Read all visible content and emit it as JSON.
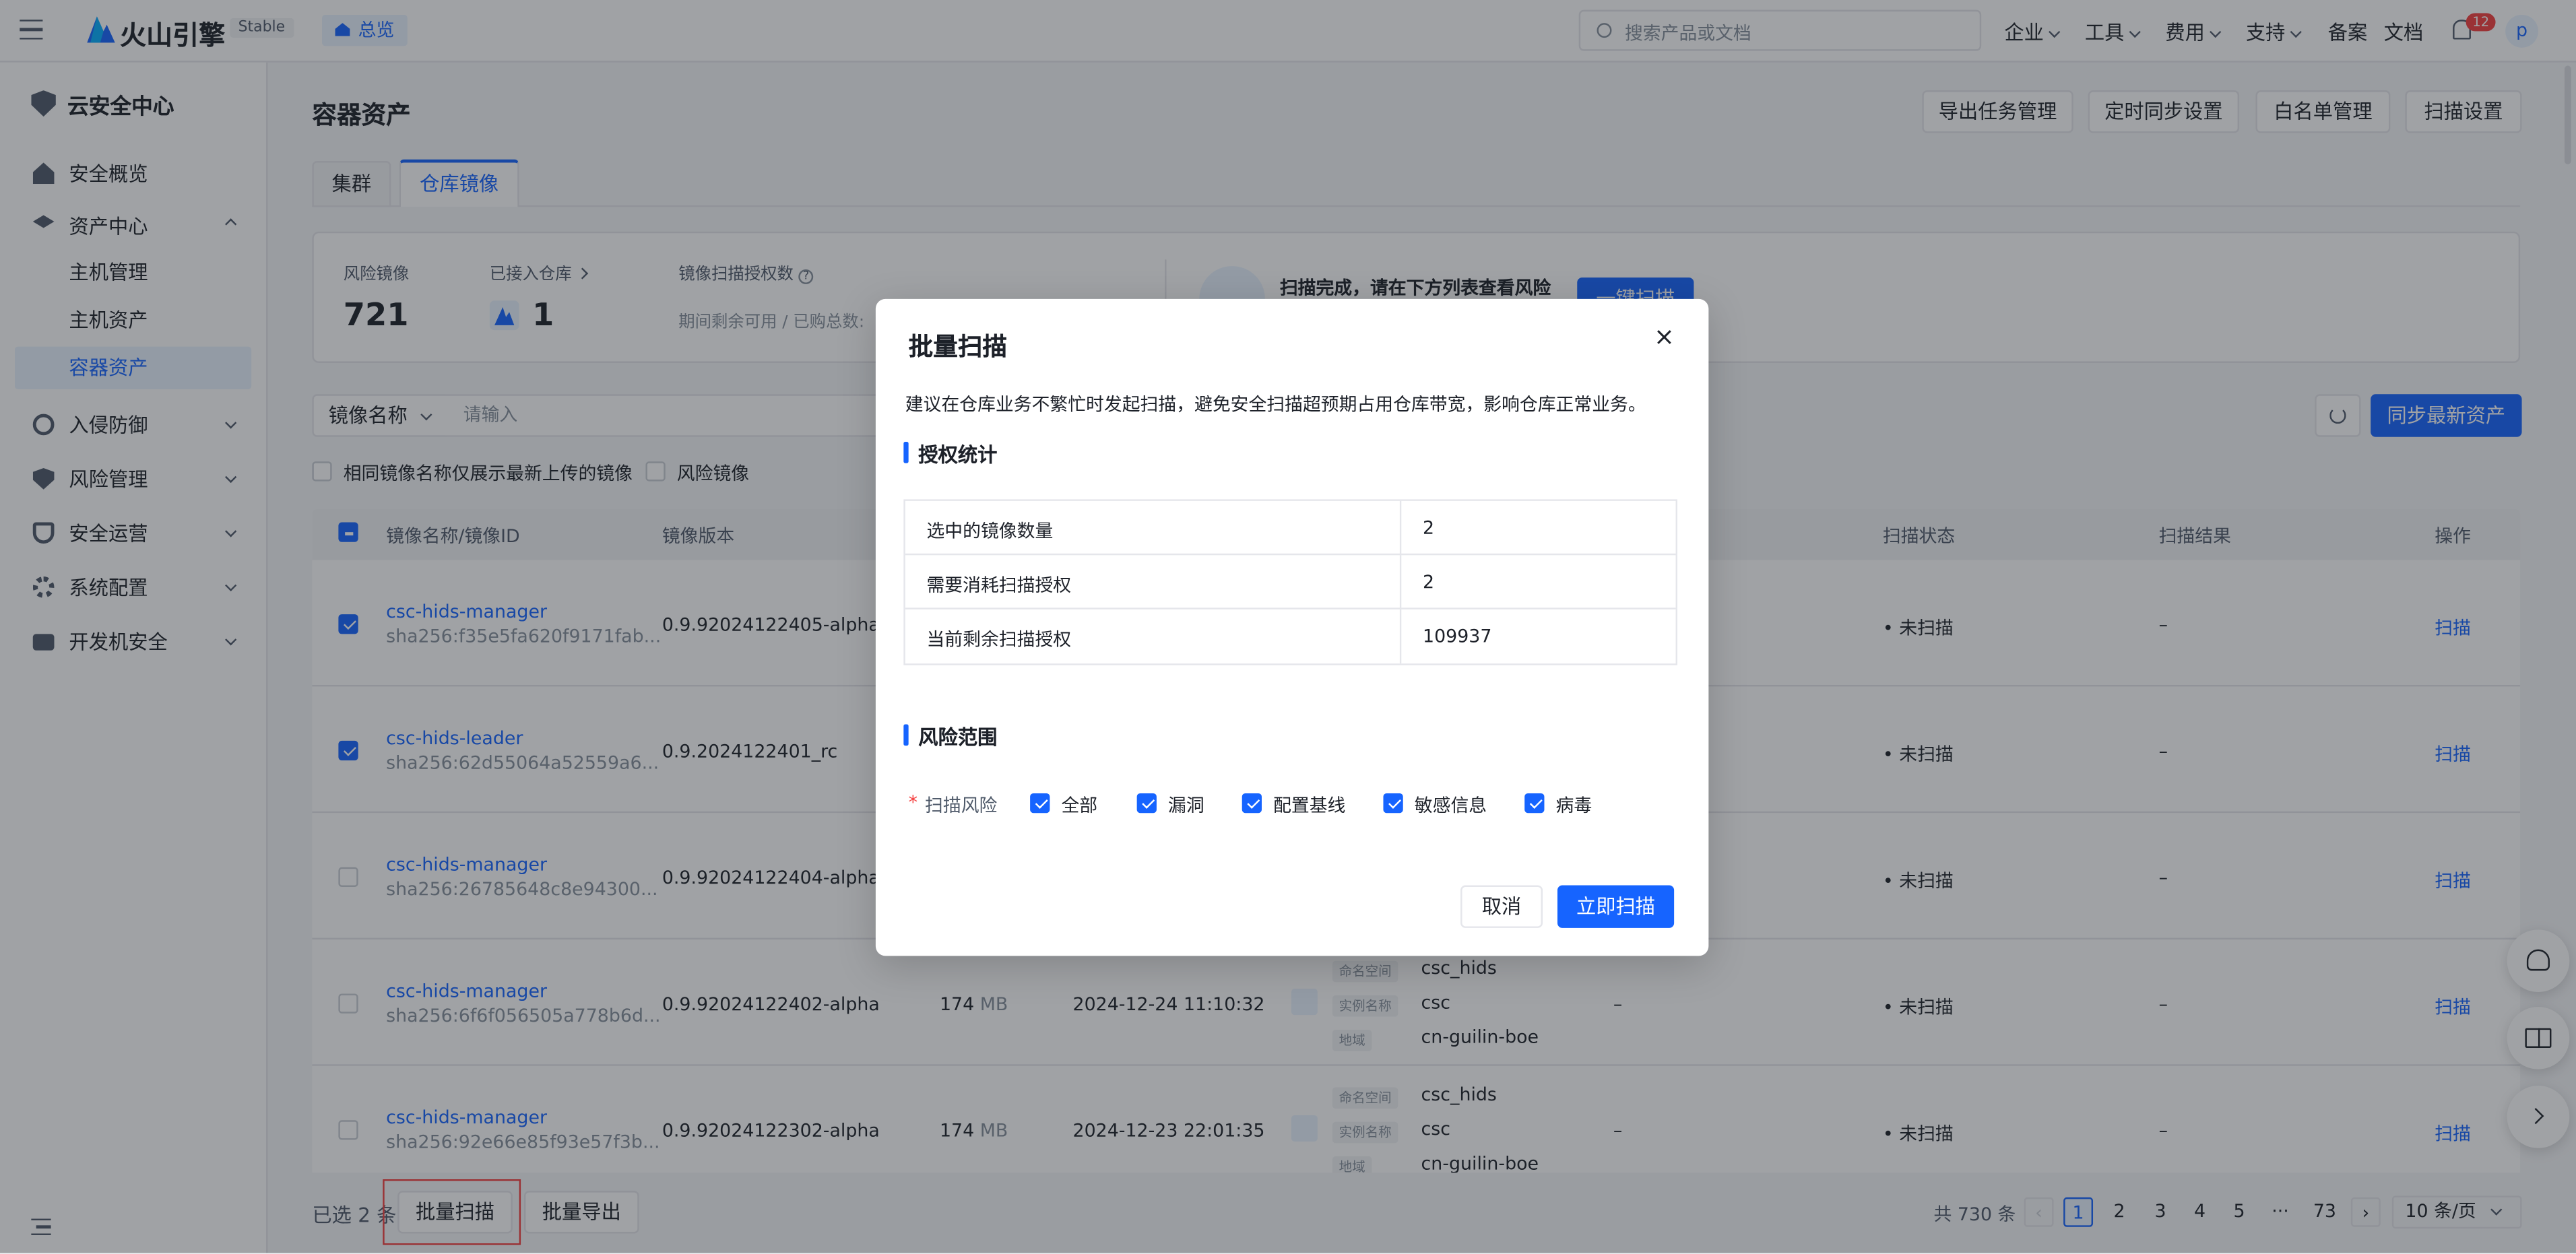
{
  "topbar": {
    "brand": "火山引擎",
    "env_badge": "Stable",
    "overview": "总览",
    "search_placeholder": "搜索产品或文档",
    "menu": [
      "企业",
      "工具",
      "费用",
      "支持",
      "备案",
      "文档"
    ],
    "notification_count": "12",
    "avatar": "p"
  },
  "sidebar": {
    "title": "云安全中心",
    "items": [
      {
        "label": "安全概览"
      },
      {
        "label": "资产中心"
      },
      {
        "label": "入侵防御"
      },
      {
        "label": "风险管理"
      },
      {
        "label": "安全运营"
      },
      {
        "label": "系统配置"
      },
      {
        "label": "开发机安全"
      }
    ],
    "asset_subitems": [
      "主机管理",
      "主机资产",
      "容器资产"
    ]
  },
  "page": {
    "title": "容器资产",
    "header_buttons": [
      "导出任务管理",
      "定时同步设置",
      "白名单管理",
      "扫描设置"
    ],
    "tabs": [
      "集群",
      "仓库镜像"
    ],
    "stats": {
      "risk_label": "风险镜像",
      "risk_value": "721",
      "repo_label": "已接入仓库",
      "repo_value": "1",
      "license_label": "镜像扫描授权数",
      "license_sub": "期间剩余可用 / 已购总数:",
      "scan_msg": "扫描完成，请在下方列表查看风险",
      "scan_btn": "一键扫描"
    },
    "filter": {
      "select": "镜像名称",
      "placeholder": "请输入",
      "sync_btn": "同步最新资产",
      "opt_latest": "相同镜像名称仅展示最新上传的镜像",
      "opt_risk": "风险镜像"
    },
    "columns": [
      "镜像名称/镜像ID",
      "镜像版本",
      "扫描状态",
      "扫描结果",
      "操作"
    ],
    "rows": [
      {
        "name": "csc-hids-manager",
        "id": "sha256:f35e5fa620f9171fab...",
        "version": "0.9.92024122405-alpha",
        "size": "",
        "time": "",
        "ns": "",
        "inst": "",
        "region": "",
        "extra": "",
        "status": "未扫描",
        "result": "–",
        "action": "扫描",
        "checked": true
      },
      {
        "name": "csc-hids-leader",
        "id": "sha256:62d55064a52559a6...",
        "version": "0.9.2024122401_rc",
        "size": "",
        "time": "",
        "ns": "",
        "inst": "",
        "region": "",
        "extra": "",
        "status": "未扫描",
        "result": "–",
        "action": "扫描",
        "checked": true
      },
      {
        "name": "csc-hids-manager",
        "id": "sha256:26785648c8e94300...",
        "version": "0.9.92024122404-alpha",
        "size": "",
        "time": "",
        "ns": "",
        "inst": "",
        "region": "",
        "extra": "",
        "status": "未扫描",
        "result": "–",
        "action": "扫描",
        "checked": false
      },
      {
        "name": "csc-hids-manager",
        "id": "sha256:6f6f056505a778b6d...",
        "version": "0.9.92024122402-alpha",
        "size": "174",
        "time": "2024-12-24 11:10:32",
        "ns": "csc_hids",
        "inst": "csc",
        "region": "cn-guilin-boe",
        "extra": "–",
        "status": "未扫描",
        "result": "–",
        "action": "扫描",
        "checked": false
      },
      {
        "name": "csc-hids-manager",
        "id": "sha256:92e66e85f93e57f3b...",
        "version": "0.9.92024122302-alpha",
        "size": "174",
        "time": "2024-12-23 22:01:35",
        "ns": "csc_hids",
        "inst": "csc",
        "region": "cn-guilin-boe",
        "extra": "–",
        "status": "未扫描",
        "result": "–",
        "action": "扫描",
        "checked": false
      }
    ],
    "size_unit": "MB",
    "meta_labels": {
      "ns": "命名空间",
      "inst": "实例名称",
      "region": "地域"
    },
    "footer": {
      "selected": "已选 2 条",
      "batch_scan": "批量扫描",
      "batch_export": "批量导出",
      "total": "共 730 条",
      "pages": [
        "1",
        "2",
        "3",
        "4",
        "5",
        "···",
        "73"
      ],
      "page_size": "10 条/页"
    }
  },
  "modal": {
    "title": "批量扫描",
    "desc": "建议在仓库业务不繁忙时发起扫描，避免安全扫描超预期占用仓库带宽，影响仓库正常业务。",
    "auth_title": "授权统计",
    "auth_rows": [
      {
        "k": "选中的镜像数量",
        "v": "2"
      },
      {
        "k": "需要消耗扫描授权",
        "v": "2"
      },
      {
        "k": "当前剩余扫描授权",
        "v": "109937"
      }
    ],
    "risk_title": "风险范围",
    "risk_label": "扫描风险",
    "risk_options": [
      "全部",
      "漏洞",
      "配置基线",
      "敏感信息",
      "病毒"
    ],
    "cancel": "取消",
    "confirm": "立即扫描"
  },
  "colors": {
    "primary": "#1664ff",
    "highlight": "#f53f3f"
  }
}
